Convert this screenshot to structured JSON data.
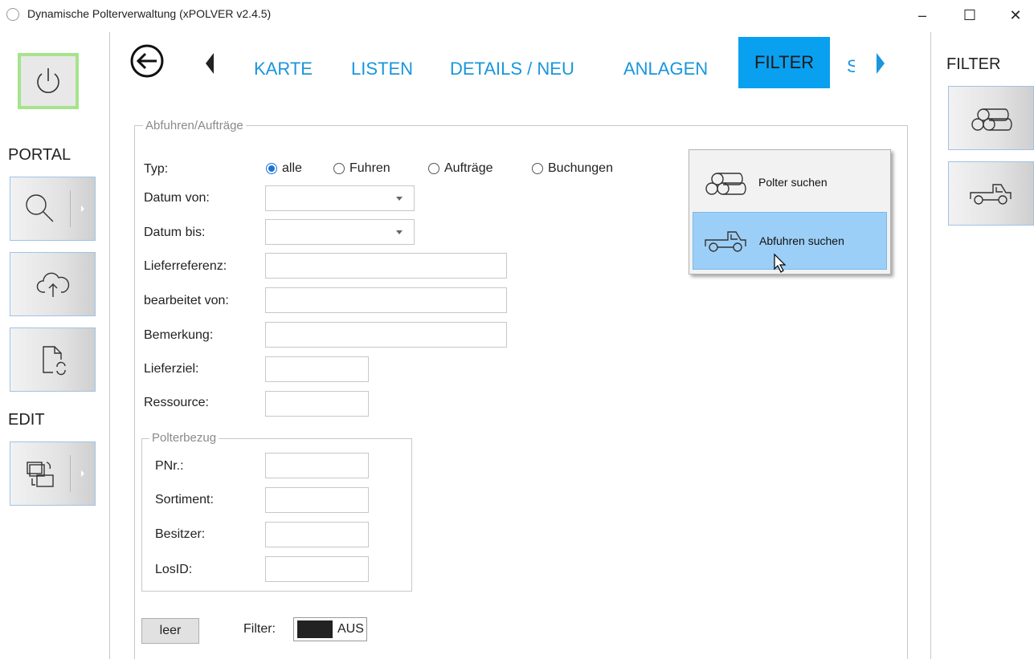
{
  "window": {
    "title": "Dynamische Polterverwaltung (xPOLVER v2.4.5)",
    "minimize": "–",
    "maximize": "☐",
    "close": "✕"
  },
  "sidebar": {
    "portal_label": "PORTAL",
    "edit_label": "EDIT"
  },
  "nav": {
    "tabs": [
      "KARTE",
      "LISTEN",
      "DETAILS / NEU",
      "ANLAGEN",
      "FILTER"
    ],
    "active_tab": "FILTER",
    "overflow_char": "S"
  },
  "form": {
    "group_title": "Abfuhren/Aufträge",
    "typ_label": "Typ:",
    "radio_options": [
      "alle",
      "Fuhren",
      "Aufträge",
      "Buchungen"
    ],
    "radio_selected": "alle",
    "labels": {
      "datum_von": "Datum von:",
      "datum_bis": "Datum bis:",
      "lieferreferenz": "Lieferreferenz:",
      "bearbeitet_von": "bearbeitet von:",
      "bemerkung": "Bemerkung:",
      "lieferziel": "Lieferziel:",
      "ressource": "Ressource:"
    },
    "values": {
      "datum_von": "",
      "datum_bis": "",
      "lieferreferenz": "",
      "bearbeitet_von": "",
      "bemerkung": "",
      "lieferziel": "",
      "ressource": ""
    },
    "polterbezug": {
      "title": "Polterbezug",
      "labels": {
        "pnr": "PNr.:",
        "sortiment": "Sortiment:",
        "besitzer": "Besitzer:",
        "losid": "LosID:"
      }
    },
    "leer_button": "leer",
    "filter_label": "Filter:",
    "filter_state": "AUS"
  },
  "popup": {
    "items": [
      "Polter suchen",
      "Abfuhren suchen"
    ],
    "highlighted": "Abfuhren suchen"
  },
  "right_sidebar": {
    "title": "FILTER"
  },
  "colors": {
    "accent": "#0aa0f0",
    "nav_text": "#1996dc",
    "power_border": "#a6e38b",
    "popup_highlight": "#9ccff7"
  }
}
